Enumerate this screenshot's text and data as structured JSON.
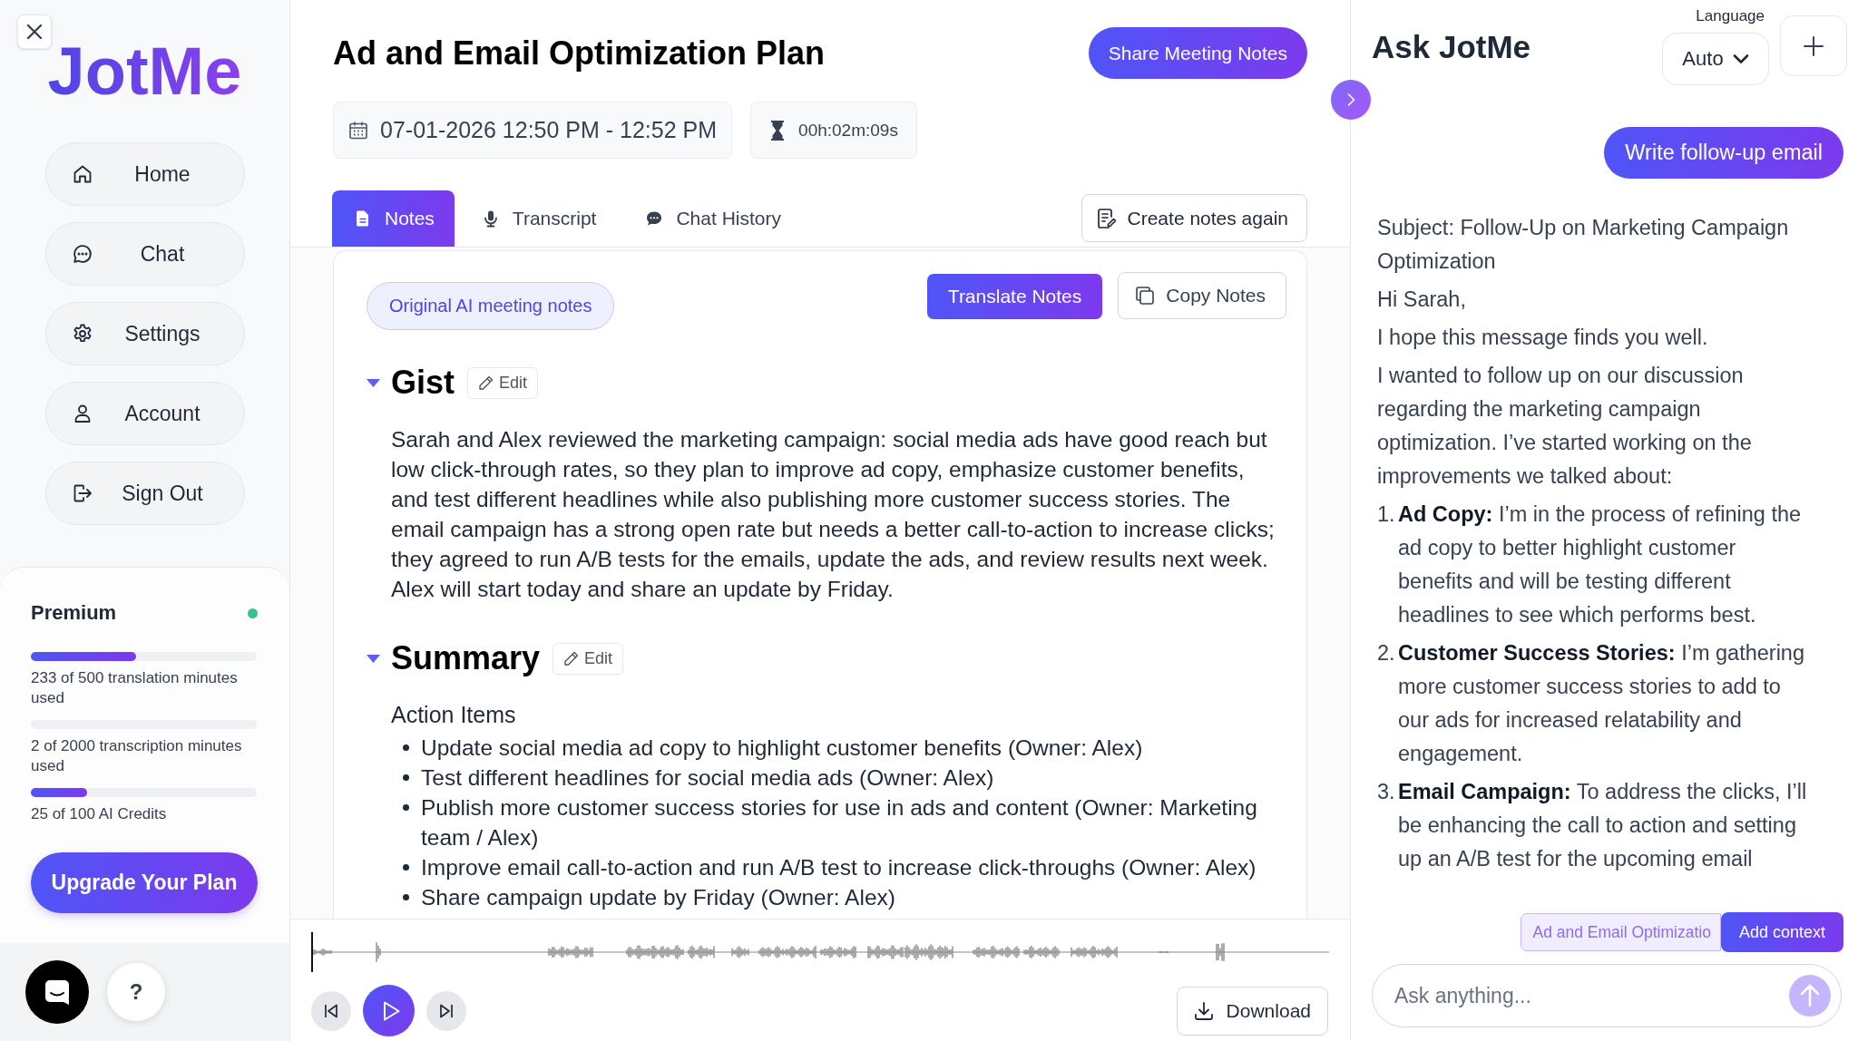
{
  "sidebar": {
    "logo": "JotMe",
    "nav_items": [
      {
        "label": "Home"
      },
      {
        "label": "Chat"
      },
      {
        "label": "Settings"
      },
      {
        "label": "Account"
      },
      {
        "label": "Sign Out"
      }
    ],
    "plan": {
      "name": "Premium",
      "active": true,
      "usage": [
        {
          "label": "233 of 500 translation minutes used",
          "level": 0.466
        },
        {
          "label": "2 of 2000 transcription minutes used",
          "level": 0.001
        },
        {
          "label": "25 of 100 AI Credits",
          "level": 0.25
        }
      ],
      "upgrade_button": "Upgrade Your Plan"
    },
    "help_button": "?"
  },
  "meeting": {
    "title": "Ad and Email Optimization Plan",
    "share_button": "Share Meeting Notes",
    "date_range": "07-01-2026 12:50 PM - 12:52 PM",
    "duration": "00h:02m:09s"
  },
  "tabs": [
    {
      "label": "Notes",
      "selected": true
    },
    {
      "label": "Transcript",
      "selected": false
    },
    {
      "label": "Chat History",
      "selected": false
    }
  ],
  "create_notes_button": "Create notes again",
  "notes": {
    "source_label": "Original AI meeting notes",
    "translate_button": "Translate Notes",
    "copy_button": "Copy Notes",
    "sections": [
      {
        "kind": "paragraph",
        "title": "Gist",
        "expanded": true,
        "edit_button": "Edit",
        "text": "Sarah and Alex reviewed the marketing campaign: social media ads have good reach but low click-through rates, so they plan to improve ad copy, emphasize customer benefits, and test different headlines while also publishing more customer success stories. The email campaign has a strong open rate but needs a better call-to-action to increase clicks; they agreed to run A/B tests for the emails, update the ads, and review results next week. Alex will start today and share an update by Friday."
      },
      {
        "kind": "list",
        "title": "Summary",
        "expanded": true,
        "edit_button": "Edit",
        "subheading": "Action Items",
        "items": [
          "Update social media ad copy to highlight customer benefits (Owner: Alex)",
          "Test different headlines for social media ads (Owner: Alex)",
          "Publish more customer success stories for use in ads and content (Owner: Marketing team / Alex)",
          "Improve email call-to-action and run A/B test to increase click-throughs (Owner: Alex)",
          "Share campaign update by Friday (Owner: Alex)"
        ]
      }
    ]
  },
  "player": {
    "playing": false,
    "download_button": "Download"
  },
  "ask_panel": {
    "title": "Ask JotMe",
    "language_label": "Language",
    "language_value": "Auto",
    "messages": [
      {
        "kind": "user",
        "text": "Write follow-up email"
      },
      {
        "kind": "assistant",
        "paragraphs": [
          "Subject: Follow-Up on Marketing Campaign Optimization",
          "Hi Sarah,",
          "I hope this message finds you well.",
          "I wanted to follow up on our discussion regarding the marketing campaign optimization. I’ve started working on the improvements we talked about:"
        ],
        "list": [
          {
            "number": "1.",
            "text": "**Ad Copy:** I’m in the process of refining the ad copy to better highlight customer benefits and will be testing different headlines to see which performs best."
          },
          {
            "number": "2.",
            "text": "**Customer Success Stories:** I’m gathering more customer success stories to add to our ads for increased relatability and engagement."
          },
          {
            "number": "3.",
            "text": "**Email Campaign:** To address the clicks, I’ll be enhancing the call to action and setting up an A/B test for the upcoming email"
          }
        ]
      }
    ],
    "context_chip": "Ad and Email Optimizatio",
    "add_context_button": "Add context",
    "input": {
      "placeholder": "Ask anything..."
    }
  }
}
